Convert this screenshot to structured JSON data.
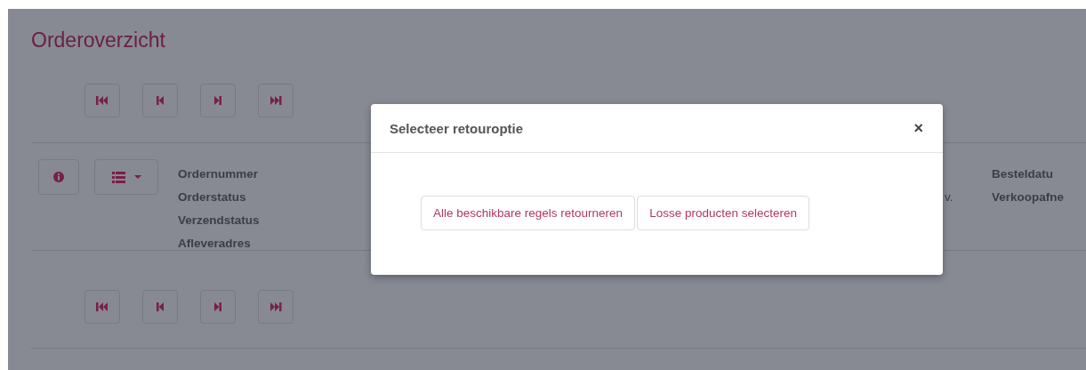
{
  "page": {
    "title": "Orderoverzicht"
  },
  "pager_top": [
    {
      "kind": "first"
    },
    {
      "kind": "previous"
    },
    {
      "kind": "next"
    },
    {
      "kind": "last"
    }
  ],
  "order_row": {
    "labels": [
      "Ordernummer",
      "Orderstatus",
      "Verzendstatus",
      "Afleveradres"
    ],
    "column_3": [
      "v."
    ],
    "column_4": [
      "Besteldatu",
      "Verkoopafne"
    ]
  },
  "pager_bottom": [
    {
      "kind": "first"
    },
    {
      "kind": "previous"
    },
    {
      "kind": "next"
    },
    {
      "kind": "last"
    }
  ],
  "modal": {
    "title": "Selecteer retouroptie",
    "close": "×",
    "buttons": [
      "Alle beschikbare regels retourneren",
      "Losse producten selecteren"
    ]
  }
}
